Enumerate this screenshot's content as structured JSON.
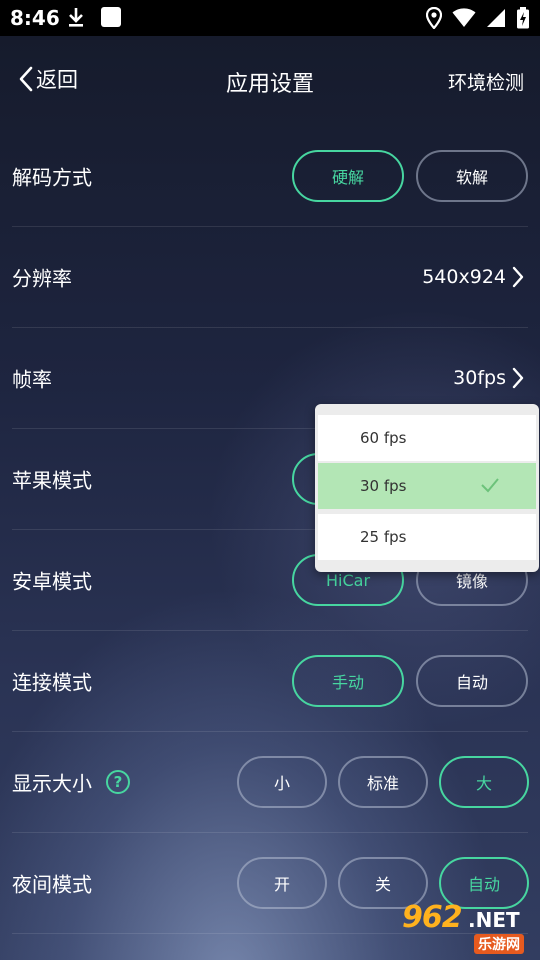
{
  "status": {
    "time": "8:46"
  },
  "nav": {
    "back_label": "返回",
    "title": "应用设置",
    "env_label": "环境检测"
  },
  "rows": {
    "decode": {
      "label": "解码方式",
      "options": [
        "硬解",
        "软解"
      ]
    },
    "resolution": {
      "label": "分辨率",
      "value": "540x924"
    },
    "framerate": {
      "label": "帧率",
      "value": "30fps"
    },
    "apple": {
      "label": "苹果模式",
      "options": [
        "",
        ""
      ]
    },
    "android": {
      "label": "安卓模式",
      "options": [
        "HiCar",
        "镜像"
      ]
    },
    "connect": {
      "label": "连接模式",
      "options": [
        "手动",
        "自动"
      ]
    },
    "display": {
      "label": "显示大小",
      "help": "?",
      "options": [
        "小",
        "标准",
        "大"
      ]
    },
    "night": {
      "label": "夜间模式",
      "options": [
        "开",
        "关",
        "自动"
      ]
    }
  },
  "dropdown": {
    "items": [
      "60 fps",
      "30 fps",
      "25 fps"
    ],
    "selected": "30 fps"
  },
  "watermark": {
    "num": "962",
    "net": ".NET",
    "sub": "乐游网"
  },
  "colors": {
    "accent": "#47d6a0",
    "selected_bg": "#b3e6b5"
  }
}
